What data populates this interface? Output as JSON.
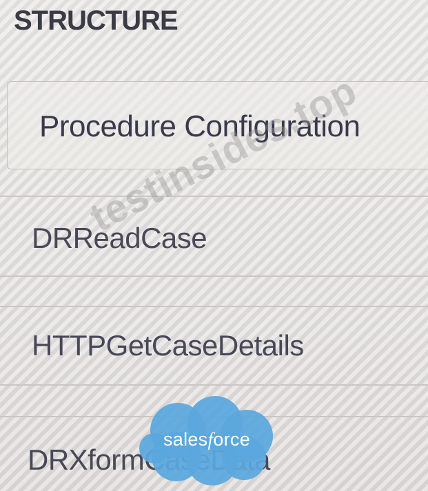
{
  "structure": {
    "header": "STRUCTURE",
    "selected_step": "Procedure Configuration",
    "steps": [
      "DRReadCase",
      "HTTPGetCaseDetails",
      "DRXformCaseData"
    ]
  },
  "watermark": "testinsides.top",
  "logo": {
    "text": "salesforce",
    "color": "#5aa7de"
  }
}
